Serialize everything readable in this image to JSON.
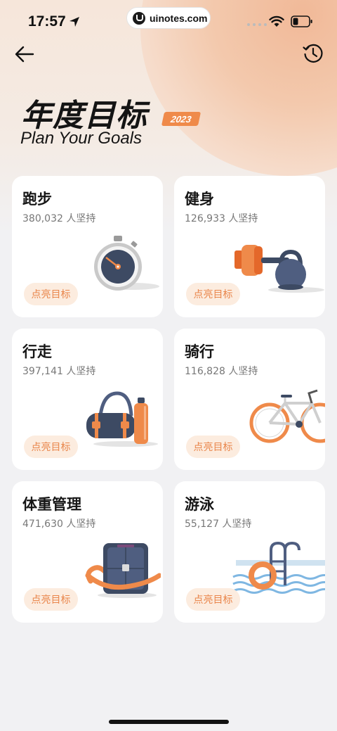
{
  "status_bar": {
    "time": "17:57",
    "site": "uinotes.com"
  },
  "header": {
    "title_cn": "年度目标",
    "year": "2023",
    "title_en": "Plan Your Goals"
  },
  "colors": {
    "accent": "#ef8a4a",
    "button_bg": "#fcecdf",
    "button_text": "#e9854a"
  },
  "goals": [
    {
      "name": "跑步",
      "count": "380,032 人坚持",
      "button": "点亮目标",
      "icon": "stopwatch-icon"
    },
    {
      "name": "健身",
      "count": "126,933 人坚持",
      "button": "点亮目标",
      "icon": "dumbbell-kettlebell-icon"
    },
    {
      "name": "行走",
      "count": "397,141 人坚持",
      "button": "点亮目标",
      "icon": "gym-bag-bottle-icon"
    },
    {
      "name": "骑行",
      "count": "116,828 人坚持",
      "button": "点亮目标",
      "icon": "bicycle-icon"
    },
    {
      "name": "体重管理",
      "count": "471,630 人坚持",
      "button": "点亮目标",
      "icon": "scale-tape-icon"
    },
    {
      "name": "游泳",
      "count": "55,127 人坚持",
      "button": "点亮目标",
      "icon": "pool-ladder-icon"
    }
  ]
}
